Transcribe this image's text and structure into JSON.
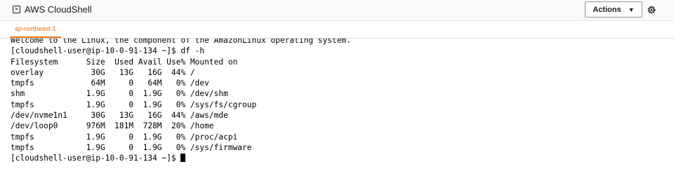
{
  "app": {
    "title": "AWS CloudShell",
    "icon": "terminal-icon"
  },
  "header": {
    "actions_label": "Actions",
    "actions_caret": "▼",
    "settings_icon": "gear-icon"
  },
  "tabs": [
    {
      "label": "ap-northeast-1",
      "active": true
    }
  ],
  "colors": {
    "accent": "#ec7211",
    "text": "#16191f"
  },
  "terminal": {
    "lines": [
      "Welcome to the Linux, the component of the AmazonLinux operating system.",
      "[cloudshell-user@ip-10-0-91-134 ~]$ df -h",
      "Filesystem      Size  Used Avail Use% Mounted on",
      "overlay          30G   13G   16G  44% /",
      "tmpfs            64M     0   64M   0% /dev",
      "shm             1.9G     0  1.9G   0% /dev/shm",
      "tmpfs           1.9G     0  1.9G   0% /sys/fs/cgroup",
      "/dev/nvme1n1     30G   13G   16G  44% /aws/mde",
      "/dev/loop0      976M  181M  728M  20% /home",
      "tmpfs           1.9G     0  1.9G   0% /proc/acpi",
      "tmpfs           1.9G     0  1.9G   0% /sys/firmware"
    ],
    "prompt": "[cloudshell-user@ip-10-0-91-134 ~]$ "
  }
}
